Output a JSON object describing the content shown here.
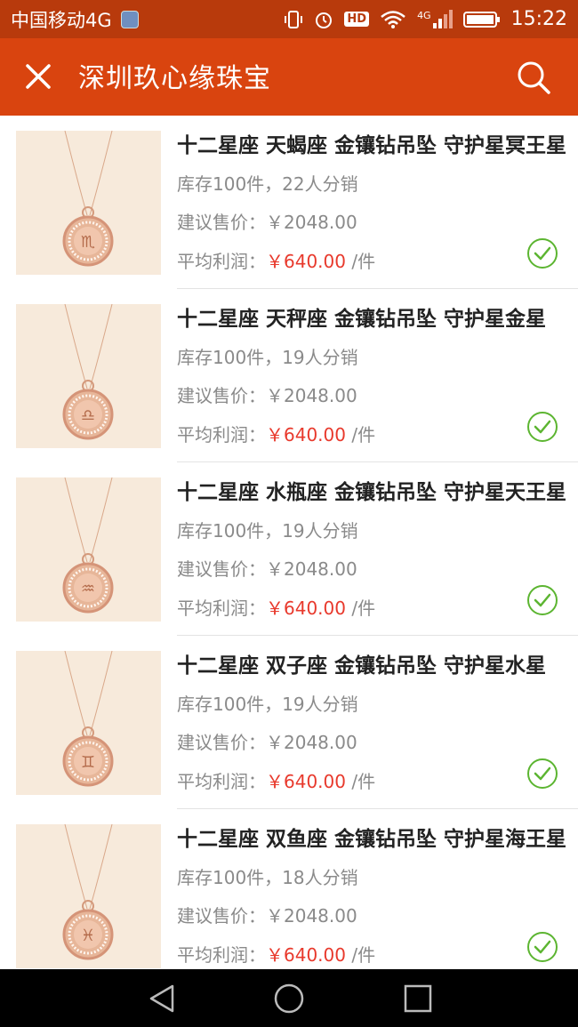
{
  "status_bar": {
    "carrier": "中国移动4G",
    "time": "15:22",
    "hd": "HD",
    "network": "4G"
  },
  "app_bar": {
    "title": "深圳玖心缘珠宝",
    "close_icon": "close-icon",
    "search_icon": "search-icon"
  },
  "items": [
    {
      "title": "十二星座 天蝎座 金镶钻吊坠 守护星冥王星",
      "stock": "库存100件，22人分销",
      "price_label": "建议售价：",
      "price": "￥2048.00",
      "profit_label": "平均利润：",
      "profit": "￥640.00",
      "profit_unit": " /件",
      "checked": true
    },
    {
      "title": "十二星座 天秤座 金镶钻吊坠 守护星金星",
      "stock": "库存100件，19人分销",
      "price_label": "建议售价：",
      "price": "￥2048.00",
      "profit_label": "平均利润：",
      "profit": "￥640.00",
      "profit_unit": " /件",
      "checked": true
    },
    {
      "title": "十二星座 水瓶座 金镶钻吊坠 守护星天王星",
      "stock": "库存100件，19人分销",
      "price_label": "建议售价：",
      "price": "￥2048.00",
      "profit_label": "平均利润：",
      "profit": "￥640.00",
      "profit_unit": " /件",
      "checked": true
    },
    {
      "title": "十二星座 双子座 金镶钻吊坠 守护星水星",
      "stock": "库存100件，19人分销",
      "price_label": "建议售价：",
      "price": "￥2048.00",
      "profit_label": "平均利润：",
      "profit": "￥640.00",
      "profit_unit": " /件",
      "checked": true
    },
    {
      "title": "十二星座 双鱼座 金镶钻吊坠 守护星海王星",
      "stock": "库存100件，18人分销",
      "price_label": "建议售价：",
      "price": "￥2048.00",
      "profit_label": "平均利润：",
      "profit": "￥640.00",
      "profit_unit": " /件",
      "checked": true
    }
  ],
  "colors": {
    "status_bar": "#b83a0c",
    "app_bar": "#d9440f",
    "profit": "#e8392c",
    "check": "#5cb531"
  }
}
